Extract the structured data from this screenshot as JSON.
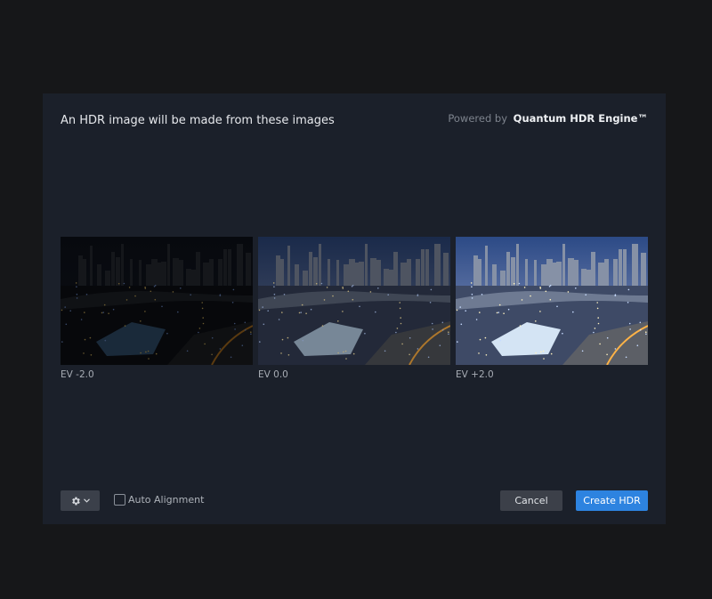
{
  "dialog": {
    "title": "An HDR image will be made from these images",
    "powered_by": "Powered by",
    "engine_name": "Quantum HDR Engine™"
  },
  "images": [
    {
      "label": "EV -2.0",
      "ev": -2.0
    },
    {
      "label": "EV 0.0",
      "ev": 0.0
    },
    {
      "label": "EV +2.0",
      "ev": 2.0
    }
  ],
  "footer": {
    "settings_icon": "gear-icon",
    "dropdown_icon": "chevron-down-icon",
    "auto_alignment_label": "Auto Alignment",
    "auto_alignment_checked": false,
    "cancel_label": "Cancel",
    "create_label": "Create HDR"
  },
  "colors": {
    "background": "#161719",
    "dialog": "#1b202a",
    "primary_button": "#2d83e0",
    "secondary_button": "#3c4049"
  }
}
